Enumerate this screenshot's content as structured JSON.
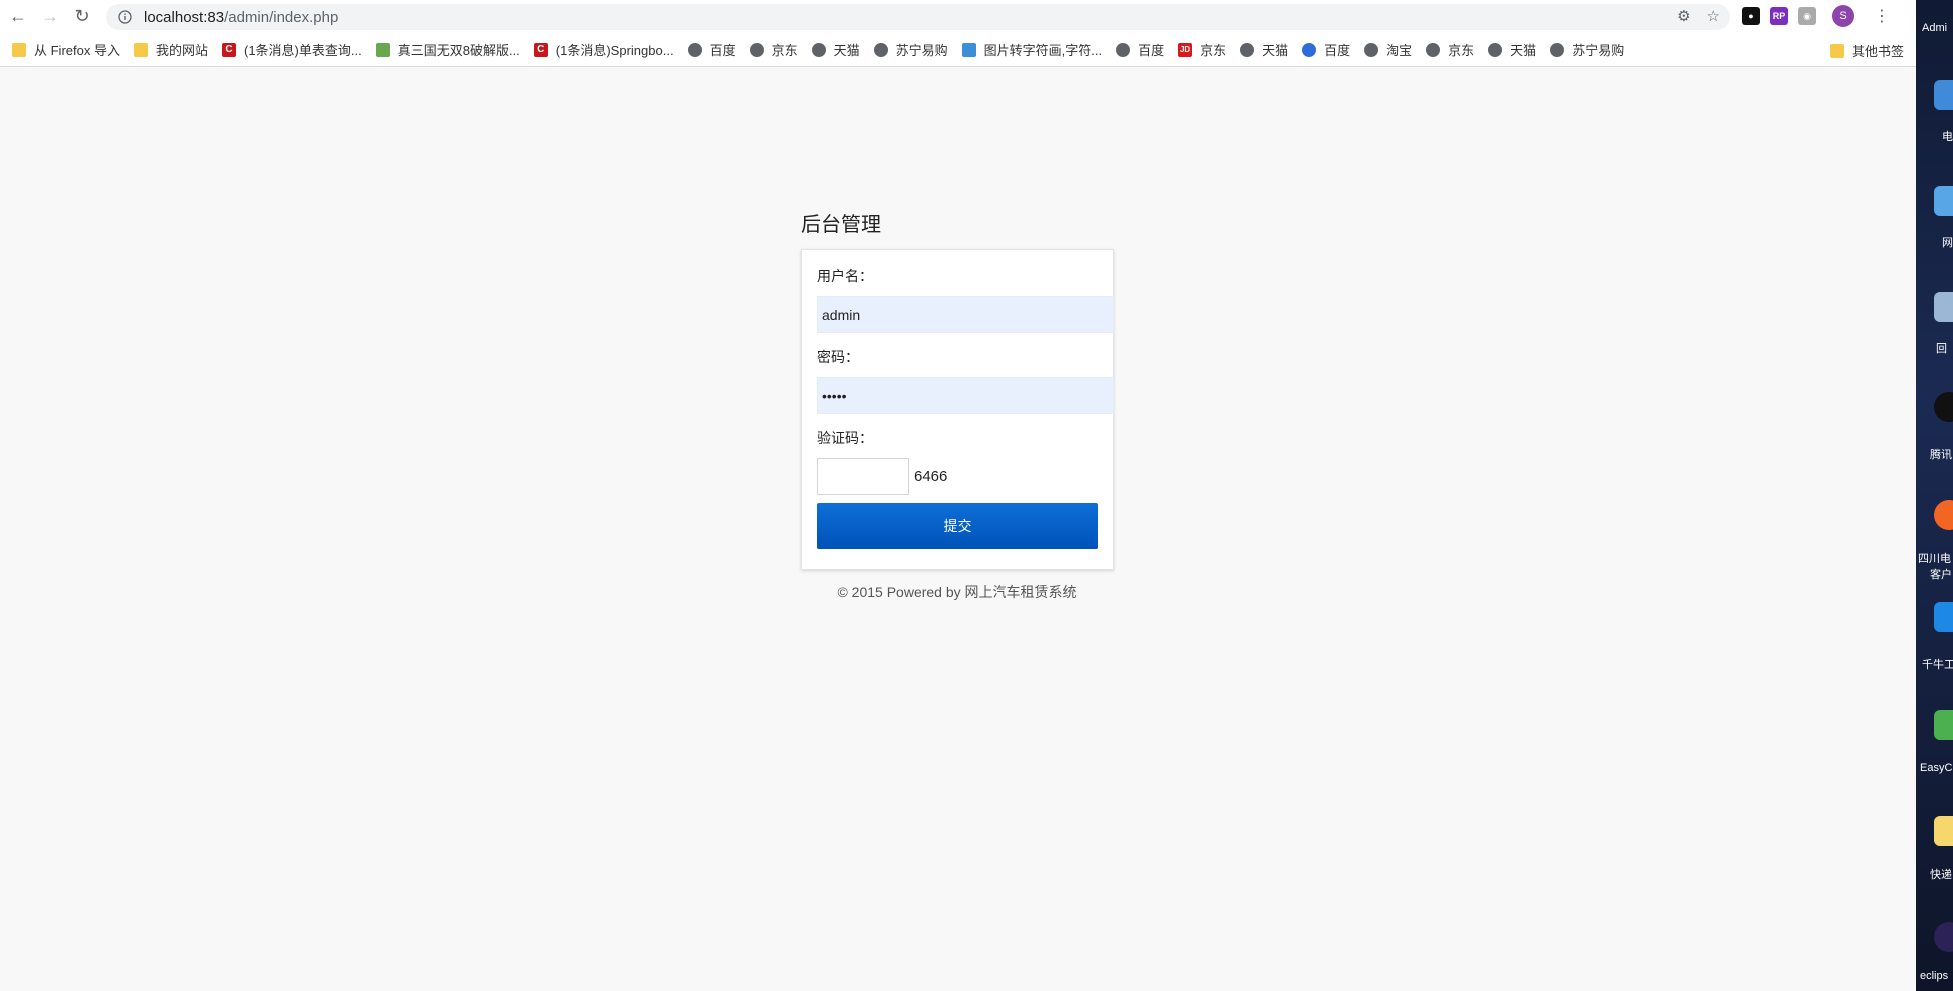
{
  "browser": {
    "url_host": "localhost:83",
    "url_path": "/admin/index.php",
    "avatar_letter": "S",
    "bookmarks": [
      {
        "label": "从 Firefox 导入",
        "icon": "folder"
      },
      {
        "label": "我的网站",
        "icon": "folder"
      },
      {
        "label": "(1条消息)单表查询...",
        "icon": "csdn"
      },
      {
        "label": "真三国无双8破解版...",
        "icon": "game"
      },
      {
        "label": "(1条消息)Springbo...",
        "icon": "csdn"
      },
      {
        "label": "百度",
        "icon": "globe"
      },
      {
        "label": "京东",
        "icon": "globe"
      },
      {
        "label": "天猫",
        "icon": "globe"
      },
      {
        "label": "苏宁易购",
        "icon": "globe"
      },
      {
        "label": "图片转字符画,字符...",
        "icon": "img"
      },
      {
        "label": "百度",
        "icon": "globe"
      },
      {
        "label": "京东",
        "icon": "jd"
      },
      {
        "label": "天猫",
        "icon": "globe"
      },
      {
        "label": "百度",
        "icon": "baidu"
      },
      {
        "label": "淘宝",
        "icon": "globe"
      },
      {
        "label": "京东",
        "icon": "globe"
      },
      {
        "label": "天猫",
        "icon": "globe"
      },
      {
        "label": "苏宁易购",
        "icon": "globe"
      }
    ],
    "other_bookmarks": "其他书签"
  },
  "desktop": {
    "labels": [
      "Admi",
      "电",
      "网",
      "回",
      "腾讯",
      "四川电",
      "客户",
      "千牛工",
      "EasyC",
      "快递",
      "eclips"
    ]
  },
  "login": {
    "title": "后台管理",
    "username_label": "用户名：",
    "username_value": "admin",
    "password_label": "密码：",
    "password_value": "admin",
    "captcha_label": "验证码：",
    "captcha_value": "",
    "captcha_code": "6466",
    "submit_label": "提交"
  },
  "footer": {
    "text": "© 2015 Powered by 网上汽车租赁系统"
  }
}
